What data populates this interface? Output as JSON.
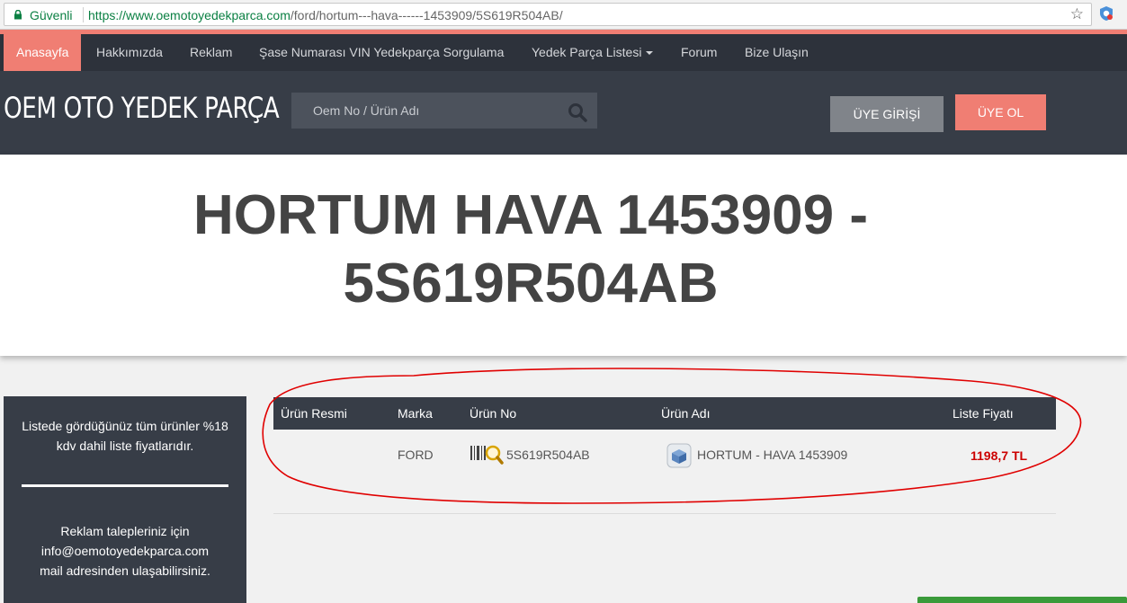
{
  "browser": {
    "secure_label": "Güvenli",
    "url_domain": "https://www.oemotoyedekparca.com",
    "url_path": "/ford/hortum---hava------1453909/5S619R504AB/"
  },
  "nav": {
    "items": [
      {
        "label": "Anasayfa"
      },
      {
        "label": "Hakkımızda"
      },
      {
        "label": "Reklam"
      },
      {
        "label": "Şase Numarası VIN Yedekparça Sorgulama"
      },
      {
        "label": "Yedek Parça Listesi"
      },
      {
        "label": "Forum"
      },
      {
        "label": "Bize Ulaşın"
      }
    ]
  },
  "header": {
    "logo": "OEM OTO YEDEK PARÇA",
    "search_placeholder": "Oem No / Ürün Adı",
    "login_label": "ÜYE GİRİŞİ",
    "register_label": "ÜYE OL"
  },
  "page": {
    "title_line1": "HORTUM HAVA 1453909 -",
    "title_line2": "5S619R504AB"
  },
  "info_panel": {
    "text1": "Listede gördüğünüz tüm ürünler %18 kdv dahil liste fiyatlarıdır.",
    "text2_line1": "Reklam talepleriniz için",
    "text2_line2": "info@oemotoyedekparca.com",
    "text2_line3": "mail adresinden ulaşabilirsiniz."
  },
  "table": {
    "headers": {
      "image": "Ürün Resmi",
      "brand": "Marka",
      "part_no": "Ürün No",
      "name": "Ürün Adı",
      "price": "Liste Fiyatı"
    },
    "rows": [
      {
        "brand": "FORD",
        "part_no": "5S619R504AB",
        "name": "HORTUM - HAVA 1453909",
        "price": "1198,7 TL"
      }
    ]
  },
  "colors": {
    "accent": "#f07e73",
    "nav_bg": "#2d323b",
    "header_bg": "#373d47",
    "price": "#cc0000",
    "annotation": "#e00000"
  },
  "icons": [
    "lock-icon",
    "star-icon",
    "extension-icon",
    "search-icon",
    "chevron-down-icon",
    "barcode-search-icon",
    "box-icon"
  ]
}
